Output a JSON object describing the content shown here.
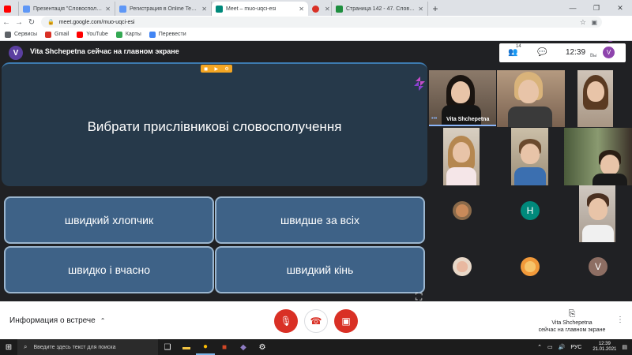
{
  "browser": {
    "tabs": [
      {
        "title": "",
        "favicon_color": "#ff0000",
        "active": false
      },
      {
        "title": "Презентація \"Словосполученн",
        "favicon_color": "#5e97f6",
        "active": false
      },
      {
        "title": "Регистрация в Online Test Pad",
        "favicon_color": "#5e97f6",
        "active": false
      },
      {
        "title": "Meet – muo-uqci-esi",
        "favicon_color": "#00897b",
        "active": true
      },
      {
        "title": "",
        "favicon_color": "#d93025",
        "active": false
      },
      {
        "title": "Страница 142 - 47. Словосполу",
        "favicon_color": "#1e8e3e",
        "active": false
      }
    ],
    "url": "meet.google.com/muo-uqci-esi",
    "bookmarks": [
      {
        "label": "Сервисы",
        "color": "#5f6368"
      },
      {
        "label": "Gmail",
        "color": "#d93025"
      },
      {
        "label": "YouTube",
        "color": "#ff0000"
      },
      {
        "label": "Карты",
        "color": "#34a853"
      },
      {
        "label": "Перевести",
        "color": "#4285f4"
      }
    ],
    "profile_initial": "V"
  },
  "meet": {
    "presenter_initial": "V",
    "presenter_banner": "Vita Shchepetna сейчас на главном экране",
    "participants_count": "14",
    "time": "12:39",
    "you_label": "Вы",
    "you_initial": "V",
    "question": "Вибрати прислівникові словосполучення",
    "answers": [
      "швидкий хлопчик",
      "швидше за всіх",
      "швидко і вчасно",
      "швидкий кінь"
    ],
    "speaker_name": "Vita Shchepetna",
    "tile_initials": {
      "h": "H",
      "v": "V"
    },
    "meeting_info": "Информация о встрече",
    "present_line1": "Vita Shchepetna",
    "present_line2": "сейчас на главном экране"
  },
  "taskbar": {
    "search_placeholder": "Введите здесь текст для поиска",
    "lang": "РУС",
    "time": "12:39",
    "date": "21.01.2021"
  }
}
